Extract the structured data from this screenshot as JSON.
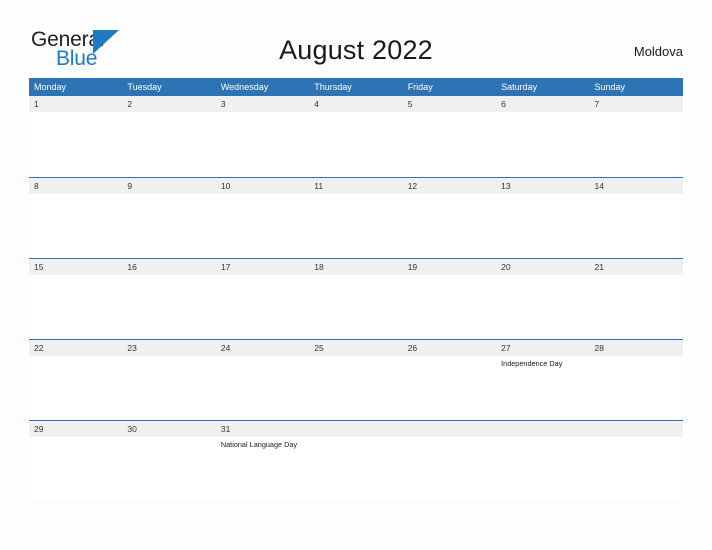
{
  "brand": {
    "word_one": "General",
    "word_two": "Blue",
    "flag_icon": "blue-triangle-flag-icon",
    "accent_color": "#1f7bc1"
  },
  "header": {
    "title": "August 2022",
    "country": "Moldova"
  },
  "theme": {
    "header_blue": "#2e74b5",
    "number_band_gray": "#f0f0f0",
    "page_background": "#fdfdfd",
    "text_color": "#1a1a1a"
  },
  "calendar": {
    "weekdays": [
      "Monday",
      "Tuesday",
      "Wednesday",
      "Thursday",
      "Friday",
      "Saturday",
      "Sunday"
    ],
    "weeks": [
      [
        {
          "day": "1",
          "event": ""
        },
        {
          "day": "2",
          "event": ""
        },
        {
          "day": "3",
          "event": ""
        },
        {
          "day": "4",
          "event": ""
        },
        {
          "day": "5",
          "event": ""
        },
        {
          "day": "6",
          "event": ""
        },
        {
          "day": "7",
          "event": ""
        }
      ],
      [
        {
          "day": "8",
          "event": ""
        },
        {
          "day": "9",
          "event": ""
        },
        {
          "day": "10",
          "event": ""
        },
        {
          "day": "11",
          "event": ""
        },
        {
          "day": "12",
          "event": ""
        },
        {
          "day": "13",
          "event": ""
        },
        {
          "day": "14",
          "event": ""
        }
      ],
      [
        {
          "day": "15",
          "event": ""
        },
        {
          "day": "16",
          "event": ""
        },
        {
          "day": "17",
          "event": ""
        },
        {
          "day": "18",
          "event": ""
        },
        {
          "day": "19",
          "event": ""
        },
        {
          "day": "20",
          "event": ""
        },
        {
          "day": "21",
          "event": ""
        }
      ],
      [
        {
          "day": "22",
          "event": ""
        },
        {
          "day": "23",
          "event": ""
        },
        {
          "day": "24",
          "event": ""
        },
        {
          "day": "25",
          "event": ""
        },
        {
          "day": "26",
          "event": ""
        },
        {
          "day": "27",
          "event": "Independence Day"
        },
        {
          "day": "28",
          "event": ""
        }
      ],
      [
        {
          "day": "29",
          "event": ""
        },
        {
          "day": "30",
          "event": ""
        },
        {
          "day": "31",
          "event": "National Language Day"
        },
        {
          "day": "",
          "event": ""
        },
        {
          "day": "",
          "event": ""
        },
        {
          "day": "",
          "event": ""
        },
        {
          "day": "",
          "event": ""
        }
      ]
    ]
  }
}
